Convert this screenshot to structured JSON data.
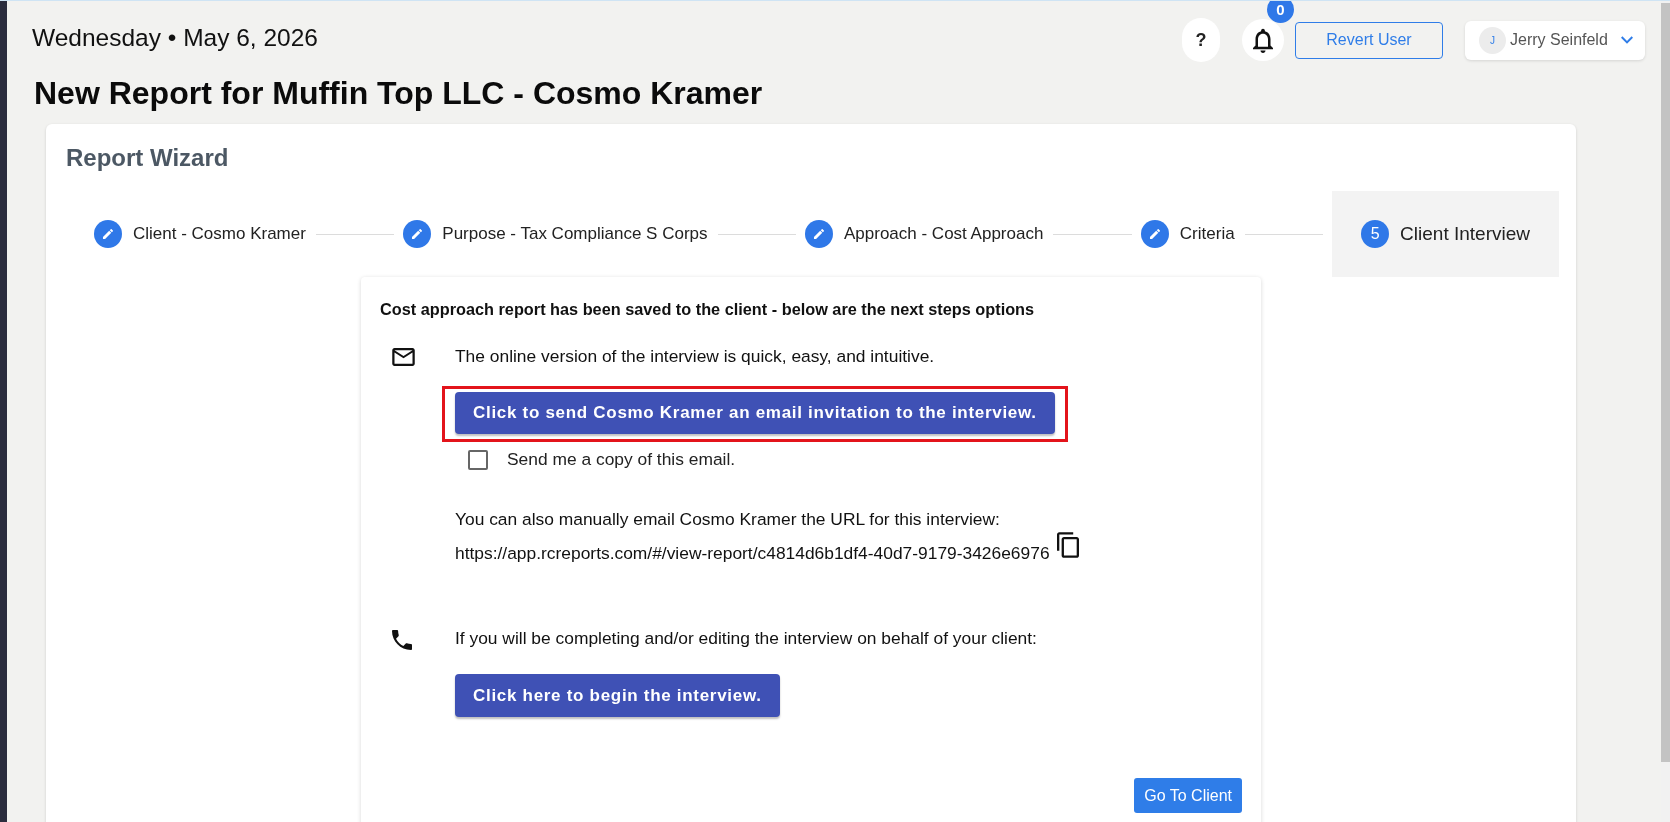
{
  "header": {
    "date": "Wednesday • May 6, 2026",
    "title": "New Report for Muffin Top LLC - Cosmo Kramer",
    "help": "?",
    "notification_count": "0",
    "revert_button": "Revert User",
    "user": {
      "initial": "J",
      "name": "Jerry Seinfeld"
    }
  },
  "wizard": {
    "title": "Report Wizard",
    "steps": [
      {
        "kind": "done",
        "label": "Client - Cosmo Kramer",
        "selected": false
      },
      {
        "kind": "done",
        "label": "Purpose - Tax Compliance S Corps",
        "selected": false
      },
      {
        "kind": "done",
        "label": "Approach - Cost Approach",
        "selected": false
      },
      {
        "kind": "done",
        "label": "Criteria",
        "selected": false
      },
      {
        "kind": "current",
        "number": "5",
        "label": "Client Interview",
        "selected": true
      }
    ]
  },
  "panel": {
    "heading": "Cost approach report has been saved to the client - below are the next steps options",
    "email": {
      "text": "The online version of the interview is quick, easy, and intuitive.",
      "invite_button": "Click to send Cosmo Kramer an email invitation to the interview.",
      "highlighted": true,
      "copy_checkbox": {
        "label": "Send me a copy of this email.",
        "checked": false
      },
      "manual_text": "You can also manually email Cosmo Kramer the URL for this interview:",
      "url": "https://app.rcreports.com/#/view-report/c4814d6b1df4-40d7-9179-3426e6976"
    },
    "phone": {
      "text": "If you will be completing and/or editing the interview on behalf of your client:",
      "begin_button": "Click here to begin the interview."
    },
    "go_to_client_button": "Go To Client"
  }
}
